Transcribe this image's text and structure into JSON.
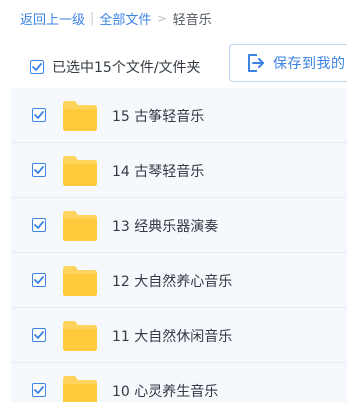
{
  "breadcrumb": {
    "back": "返回上一级",
    "separator": "|",
    "all_files": "全部文件",
    "arrow": ">",
    "current": "轻音乐"
  },
  "toolbar": {
    "select_all_label": "已选中15个文件/文件夹",
    "save_button_label": "保存到我的",
    "accent_color": "#3b84e6"
  },
  "files": [
    {
      "name": "15 古筝轻音乐",
      "checked": true,
      "icon": "folder-icon"
    },
    {
      "name": "14 古琴轻音乐",
      "checked": true,
      "icon": "folder-icon"
    },
    {
      "name": "13 经典乐器演奏",
      "checked": true,
      "icon": "folder-icon"
    },
    {
      "name": "12 大自然养心音乐",
      "checked": true,
      "icon": "folder-icon"
    },
    {
      "name": "11 大自然休闲音乐",
      "checked": true,
      "icon": "folder-icon"
    },
    {
      "name": "10 心灵养生音乐",
      "checked": true,
      "icon": "folder-icon"
    }
  ]
}
